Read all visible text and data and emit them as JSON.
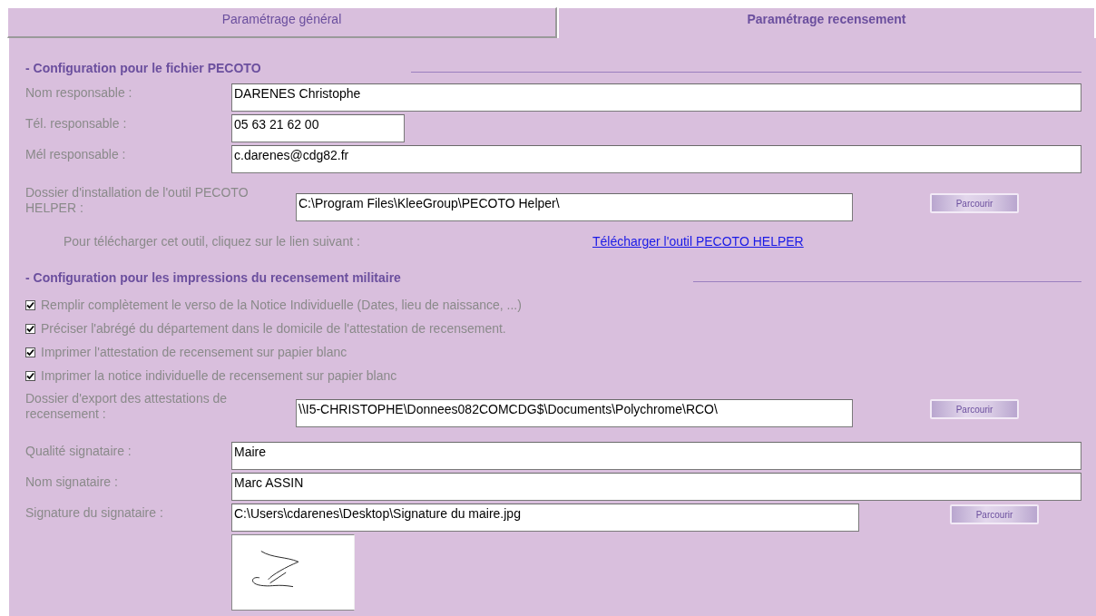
{
  "tabs": [
    {
      "label": "Paramétrage général",
      "selected": false
    },
    {
      "label": "Paramétrage recensement",
      "selected": true
    }
  ],
  "sections": [
    {
      "heading": "- Configuration pour le fichier PECOTO",
      "items": [
        {
          "kind": "field",
          "label": "Nom responsable :",
          "value": "DARENES Christophe"
        },
        {
          "kind": "short_field",
          "label": "Tél. responsable :",
          "value": "05 63 21 62 00"
        },
        {
          "kind": "field",
          "label": "Mél responsable :",
          "value": "c.darenes@cdg82.fr"
        },
        {
          "kind": "folder",
          "label": "Dossier d'installation de l'outil PECOTO HELPER :",
          "value": "C:\\Program Files\\KleeGroup\\PECOTO Helper\\",
          "button": "Parcourir"
        },
        {
          "kind": "link",
          "label": "Pour télécharger cet outil, cliquez sur le lien suivant :",
          "link": "Télécharger l'outil PECOTO HELPER"
        }
      ]
    },
    {
      "heading": "- Configuration pour les impressions du recensement militaire",
      "items": [
        {
          "kind": "checkbox",
          "label": "Remplir complètement le verso de la Notice Individuelle (Dates, lieu de naissance, ...)",
          "checked": true
        },
        {
          "kind": "checkbox",
          "label": "Préciser l'abrégé du département dans le domicile de l'attestation de recensement.",
          "checked": true
        },
        {
          "kind": "checkbox",
          "label": "Imprimer l'attestation de recensement sur papier blanc",
          "checked": true
        },
        {
          "kind": "checkbox",
          "label": "Imprimer la notice individuelle de recensement sur papier blanc",
          "checked": true
        },
        {
          "kind": "folder",
          "label": "Dossier d'export des attestations de recensement :",
          "value": "\\\\I5-CHRISTOPHE\\Donnees082COMCDG$\\Documents\\Polychrome\\RCO\\",
          "button": "Parcourir"
        },
        {
          "kind": "field",
          "label": "Qualité signataire :",
          "value": "Maire"
        },
        {
          "kind": "field",
          "label": "Nom signataire :",
          "value": "Marc ASSIN"
        },
        {
          "kind": "file",
          "label": "Signature du signataire :",
          "value": "C:\\Users\\cdarenes\\Desktop\\Signature du maire.jpg",
          "button": "Parcourir"
        },
        {
          "kind": "image"
        }
      ]
    }
  ]
}
